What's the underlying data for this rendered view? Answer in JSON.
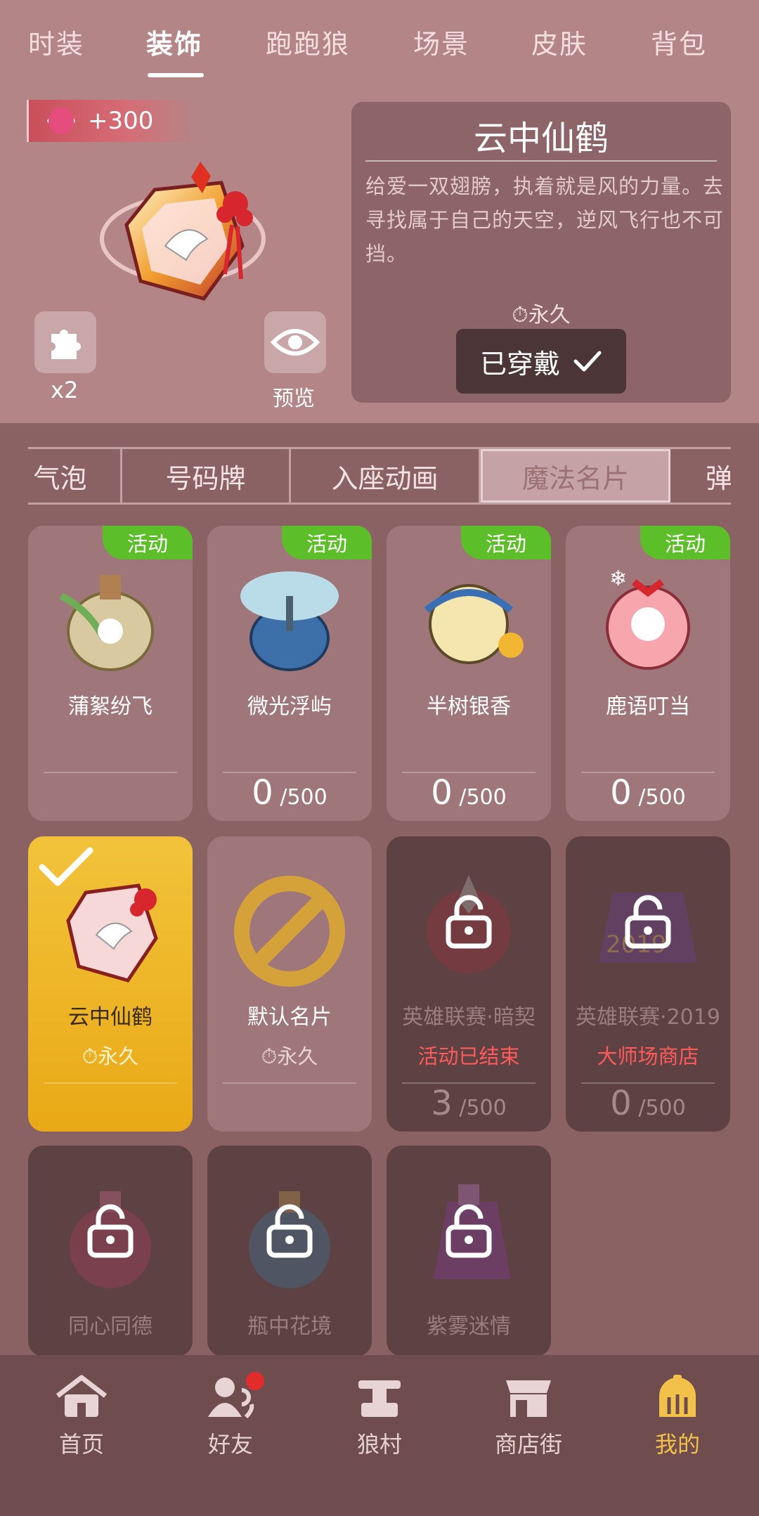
{
  "top_tabs": [
    "时装",
    "装饰",
    "跑跑狼",
    "场景",
    "皮肤",
    "背包"
  ],
  "header": {
    "points": "+300",
    "fragments_count": "x2",
    "preview_label": "预览"
  },
  "detail": {
    "title": "云中仙鹤",
    "description": "给爱一双翅膀，执着就是风的力量。去寻找属于自己的天空，逆风飞行也不可挡。",
    "duration": "永久",
    "worn_label": "已穿戴"
  },
  "sub_tabs": [
    "气泡",
    "号码牌",
    "入座动画",
    "魔法名片",
    "弹"
  ],
  "cards": [
    {
      "name": "蒲絮纷飞",
      "badge": "活动",
      "count": "",
      "total": ""
    },
    {
      "name": "微光浮屿",
      "badge": "活动",
      "count": "0",
      "total": "/500"
    },
    {
      "name": "半树银香",
      "badge": "活动",
      "count": "0",
      "total": "/500"
    },
    {
      "name": "鹿语叮当",
      "badge": "活动",
      "count": "0",
      "total": "/500"
    },
    {
      "name": "云中仙鹤",
      "sub": "永久",
      "selected": true
    },
    {
      "name": "默认名片",
      "sub": "永久"
    },
    {
      "name": "英雄联赛·暗契",
      "sub": "活动已结束",
      "count": "3",
      "total": "/500",
      "locked": true
    },
    {
      "name": "英雄联赛·2019",
      "sub": "大师场商店",
      "count": "0",
      "total": "/500",
      "locked": true
    },
    {
      "name": "同心同德",
      "locked": true
    },
    {
      "name": "瓶中花境",
      "locked": true
    },
    {
      "name": "紫雾迷情",
      "locked": true
    }
  ],
  "bottom_nav": [
    "首页",
    "好友",
    "狼村",
    "商店街",
    "我的"
  ],
  "colors": {
    "accent_gold": "#f2c14a",
    "badge_green": "#5cbf2a",
    "alert_red": "#ff5a5a"
  }
}
